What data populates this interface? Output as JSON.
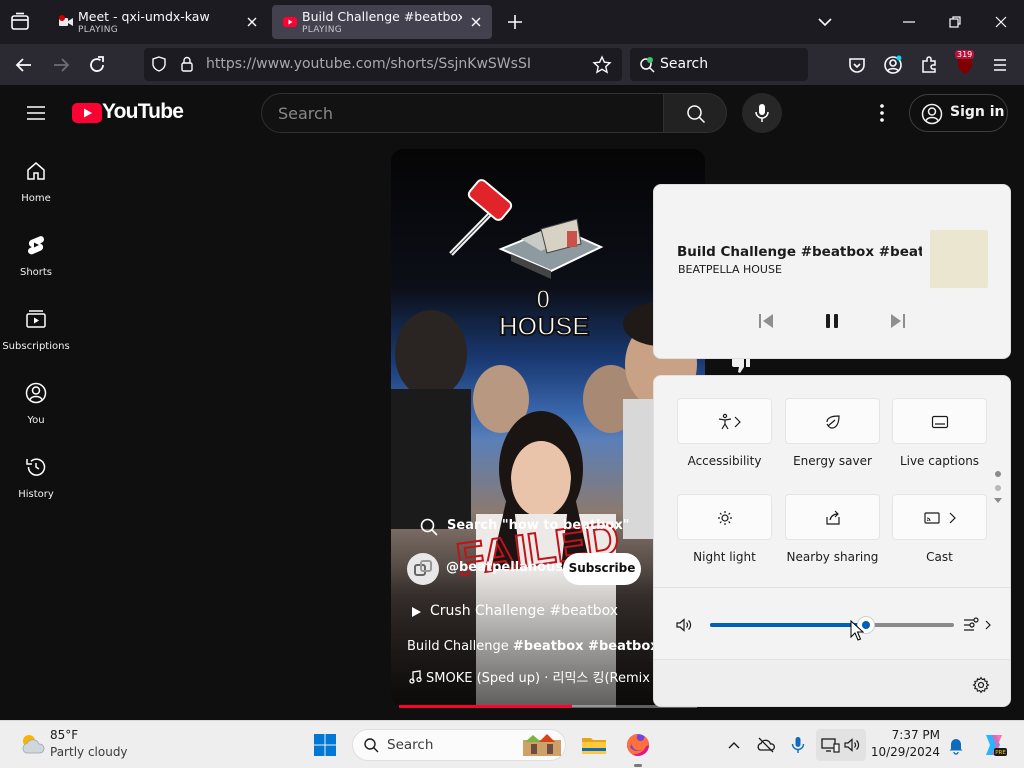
{
  "browser": {
    "tabs": [
      {
        "title": "Meet - qxi-umdx-kaw",
        "status": "PLAYING"
      },
      {
        "title": "Build Challenge #beatbox #beatboxchallenge",
        "status": "PLAYING"
      }
    ],
    "url_host": "https://www.youtube.com",
    "url_path": "/shorts/SsjnKwSWsSI",
    "search_placeholder": "Search",
    "extension_badge": "319"
  },
  "youtube": {
    "logo_text": "YouTube",
    "search_placeholder": "Search",
    "signin_label": "Sign in",
    "sidebar": [
      {
        "label": "Home",
        "icon": "home-icon"
      },
      {
        "label": "Shorts",
        "icon": "shorts-icon"
      },
      {
        "label": "Subscriptions",
        "icon": "subscriptions-icon"
      },
      {
        "label": "You",
        "icon": "account-icon"
      },
      {
        "label": "History",
        "icon": "history-icon"
      }
    ],
    "short": {
      "overlay_zero": "0",
      "overlay_house": "HOUSE",
      "search_suggestion": "Search \"how to beatbox\"",
      "channel": "@beatpellahouse",
      "subscribe_label": "Subscribe",
      "related": "Crush Challenge #beatbox",
      "title_prefix": "Build Challenge ",
      "title_tags": "#beatbox #beatboxchallenge",
      "music": "SMOKE (Sped up) · 리믹스 킹(Remix King)",
      "progress_fraction": 0.58
    }
  },
  "media_flyout": {
    "title": "Build Challenge #beatbox #beatbox...",
    "artist": "BEATPELLA HOUSE"
  },
  "quick_settings": {
    "tiles": [
      {
        "label": "Accessibility",
        "icon": "accessibility-icon",
        "has_chevron": true
      },
      {
        "label": "Energy saver",
        "icon": "energy-saver-icon",
        "has_chevron": false
      },
      {
        "label": "Live captions",
        "icon": "live-captions-icon",
        "has_chevron": false
      },
      {
        "label": "Night light",
        "icon": "night-light-icon",
        "has_chevron": false
      },
      {
        "label": "Nearby sharing",
        "icon": "nearby-sharing-icon",
        "has_chevron": false
      },
      {
        "label": "Cast",
        "icon": "cast-icon",
        "has_chevron": true
      }
    ],
    "volume_fraction": 0.64,
    "accent_color": "#005fb8"
  },
  "taskbar": {
    "weather_temp": "85°F",
    "weather_desc": "Partly cloudy",
    "search_label": "Search",
    "time": "7:37 PM",
    "date": "10/29/2024"
  }
}
